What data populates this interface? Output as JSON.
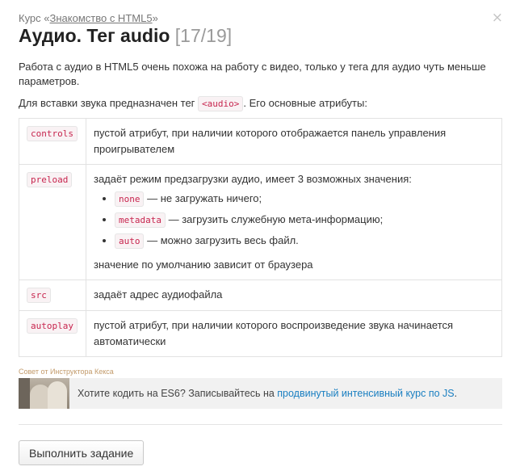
{
  "breadcrumb": {
    "prefix": "Курс «",
    "course": "Знакомство с HTML5",
    "suffix": "»"
  },
  "close_glyph": "×",
  "title": {
    "text": "Аудио. Тег audio",
    "counter": "[17/19]"
  },
  "intro": "Работа с аудио в HTML5 очень похожа на работу с видео, только у тега для аудио чуть меньше параметров.",
  "insert": {
    "before": "Для вставки звука предназначен тег ",
    "tag": "<audio>",
    "after": ". Его основные атрибуты:"
  },
  "attributes": [
    {
      "name": "controls",
      "description": "пустой атрибут, при наличии которого отображается панель управления проигрывателем"
    },
    {
      "name": "preload",
      "description": "задаёт режим предзагрузки аудио, имеет 3 возможных значения:",
      "values": [
        {
          "code": "none",
          "text": " — не загружать ничего;"
        },
        {
          "code": "metadata",
          "text": " — загрузить служебную мета-информацию;"
        },
        {
          "code": "auto",
          "text": " — можно загрузить весь файл."
        }
      ],
      "note": "значение по умолчанию зависит от браузера"
    },
    {
      "name": "src",
      "description": "задаёт адрес аудиофайла"
    },
    {
      "name": "autoplay",
      "description": "пустой атрибут, при наличии которого воспроизведение звука начинается автоматически"
    }
  ],
  "tip": {
    "label": "Совет от Инструктора Кекса",
    "before": "Хотите кодить на ES6? Записывайтесь на ",
    "link": "продвинутый интенсивный курс по JS",
    "after": "."
  },
  "submit_label": "Выполнить задание",
  "colors": {
    "code_text": "#c7254e",
    "link": "#1a7fc1",
    "tip_label": "#c29a6a"
  }
}
